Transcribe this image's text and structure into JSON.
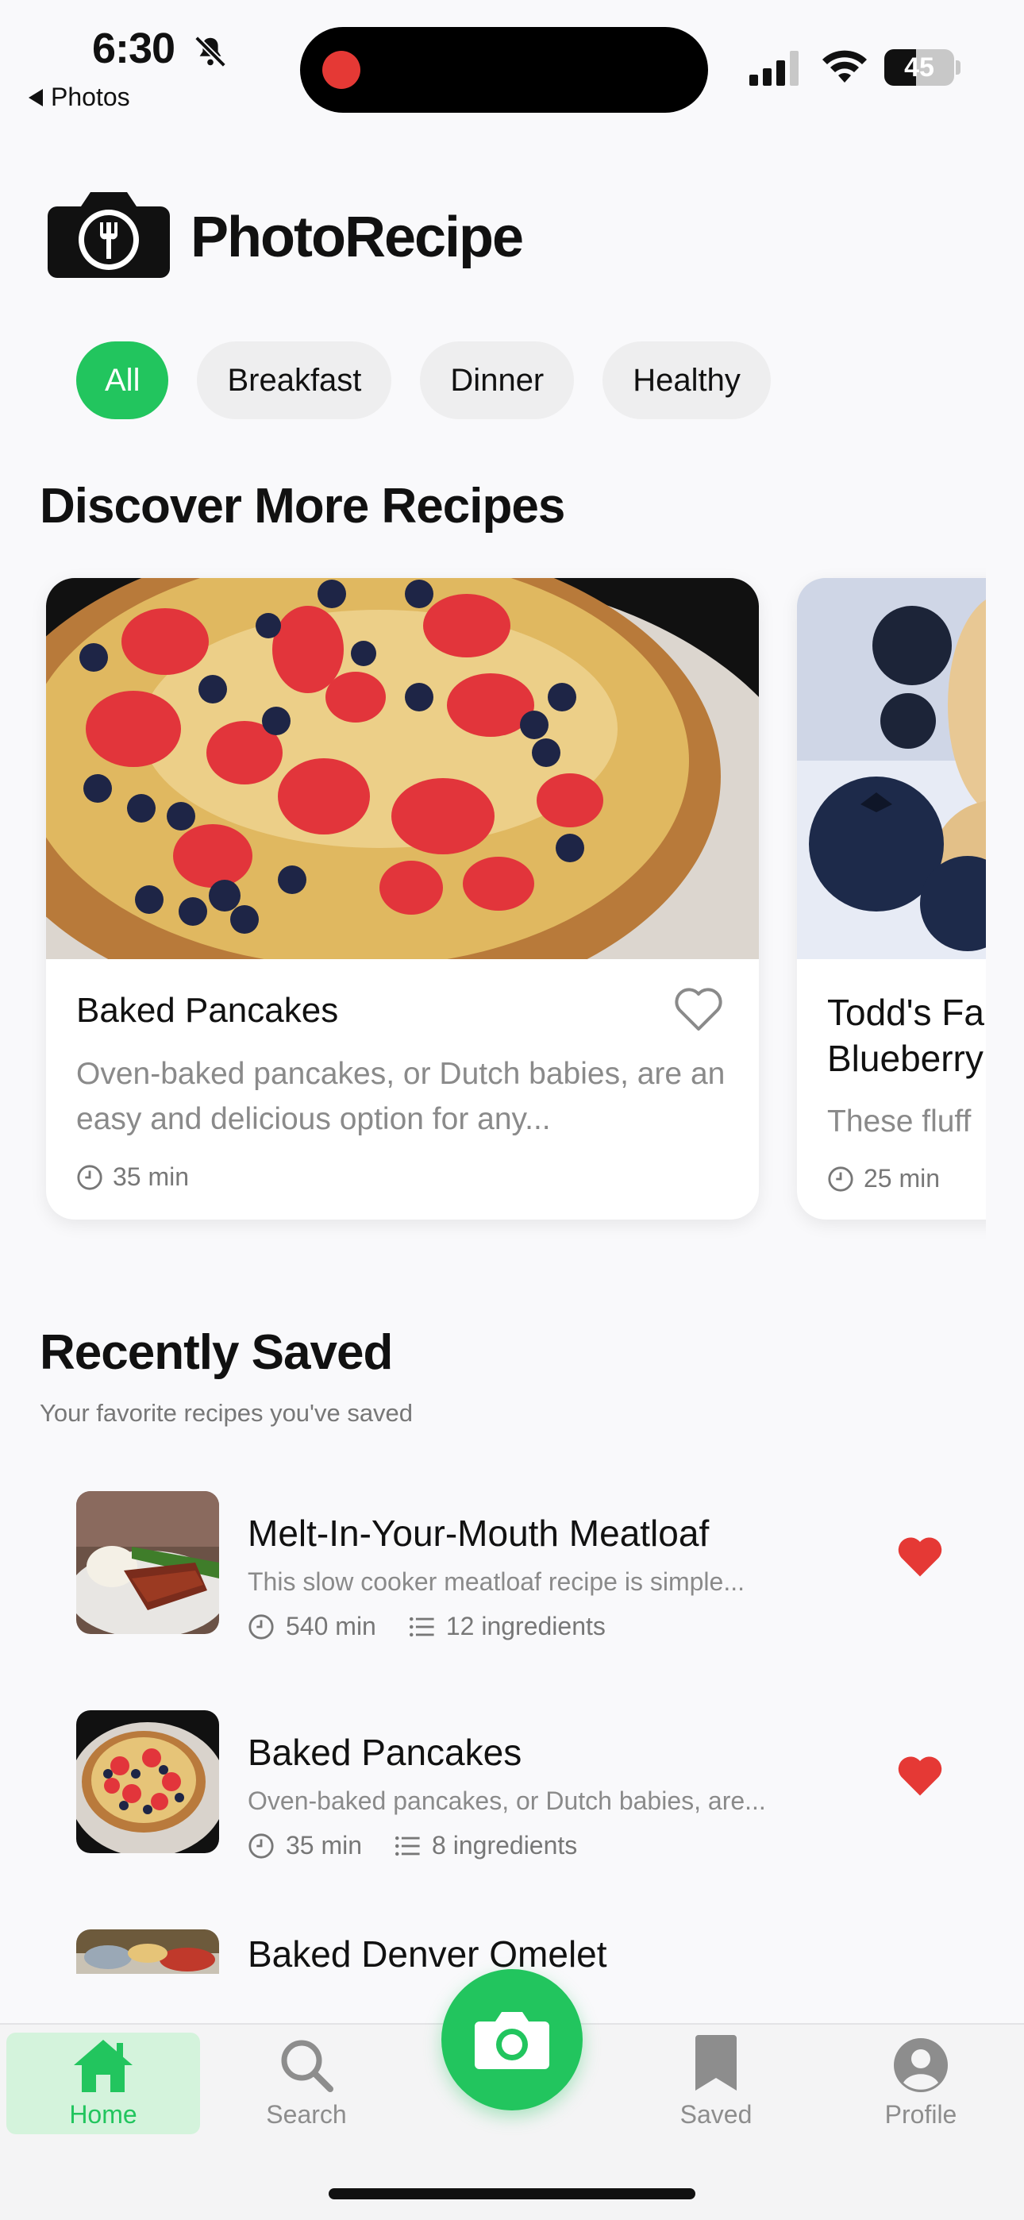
{
  "status_bar": {
    "time": "6:30",
    "back_label": "Photos",
    "battery": "45",
    "battery_level": 0.45
  },
  "header": {
    "app_name": "PhotoRecipe"
  },
  "filters": {
    "chips": [
      "All",
      "Breakfast",
      "Dinner",
      "Healthy"
    ],
    "active": "All"
  },
  "discover": {
    "title": "Discover More Recipes",
    "cards": [
      {
        "title": "Baked Pancakes",
        "description": "Oven-baked pancakes, or Dutch babies, are an easy and delicious option for any...",
        "time": "35 min",
        "favorited": false
      },
      {
        "title": "Todd's Famous Blueberry",
        "title_line1": "Todd's Fa",
        "title_line2": "Blueberry",
        "description": "These fluff",
        "time": "25 min"
      }
    ]
  },
  "recent": {
    "title": "Recently Saved",
    "subtitle": "Your favorite recipes you've saved",
    "items": [
      {
        "title": "Melt-In-Your-Mouth Meatloaf",
        "description": "This slow cooker meatloaf recipe is simple...",
        "time": "540 min",
        "ingredients": "12 ingredients",
        "favorited": true
      },
      {
        "title": "Baked Pancakes",
        "description": "Oven-baked pancakes, or Dutch babies, are...",
        "time": "35 min",
        "ingredients": "8 ingredients",
        "favorited": true
      },
      {
        "title": "Baked Denver Omelet"
      }
    ]
  },
  "tabbar": {
    "home": "Home",
    "search": "Search",
    "saved": "Saved",
    "profile": "Profile",
    "active": "Home"
  },
  "colors": {
    "accent": "#22c55e",
    "heart": "#e53935",
    "chip_bg": "#eeeeef"
  }
}
